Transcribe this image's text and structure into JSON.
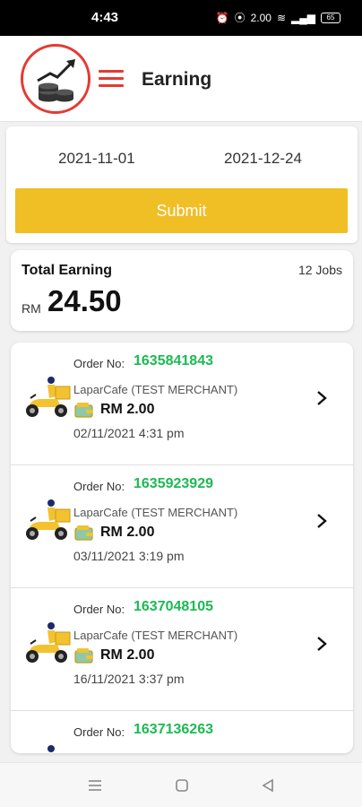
{
  "status_bar": {
    "time": "4:43",
    "data_speed": "2.00",
    "battery": "65"
  },
  "header": {
    "title": "Earning"
  },
  "date_filter": {
    "from": "2021-11-01",
    "to": "2021-12-24",
    "submit_label": "Submit"
  },
  "summary": {
    "label": "Total Earning",
    "jobs": "12 Jobs",
    "currency": "RM",
    "amount": "24.50"
  },
  "orders": [
    {
      "label": "Order No:",
      "number": "1635841843",
      "merchant": "LaparCafe (TEST MERCHANT)",
      "amount": "RM 2.00",
      "datetime": "02/11/2021 4:31 pm"
    },
    {
      "label": "Order No:",
      "number": "1635923929",
      "merchant": "LaparCafe (TEST MERCHANT)",
      "amount": "RM 2.00",
      "datetime": "03/11/2021 3:19 pm"
    },
    {
      "label": "Order No:",
      "number": "1637048105",
      "merchant": "LaparCafe (TEST MERCHANT)",
      "amount": "RM 2.00",
      "datetime": "16/11/2021 3:37 pm"
    },
    {
      "label": "Order No:",
      "number": "1637136263"
    }
  ],
  "icons": {
    "logo": "coins-growth-logo",
    "menu": "hamburger-menu-icon",
    "order": "delivery-scooter-icon",
    "wallet": "wallet-icon",
    "chevron": "chevron-right-icon",
    "nav": [
      "recent-apps-icon",
      "home-icon",
      "back-icon"
    ]
  },
  "colors": {
    "accent_red": "#e43a33",
    "submit_yellow": "#f0be25",
    "order_green": "#1db954"
  }
}
